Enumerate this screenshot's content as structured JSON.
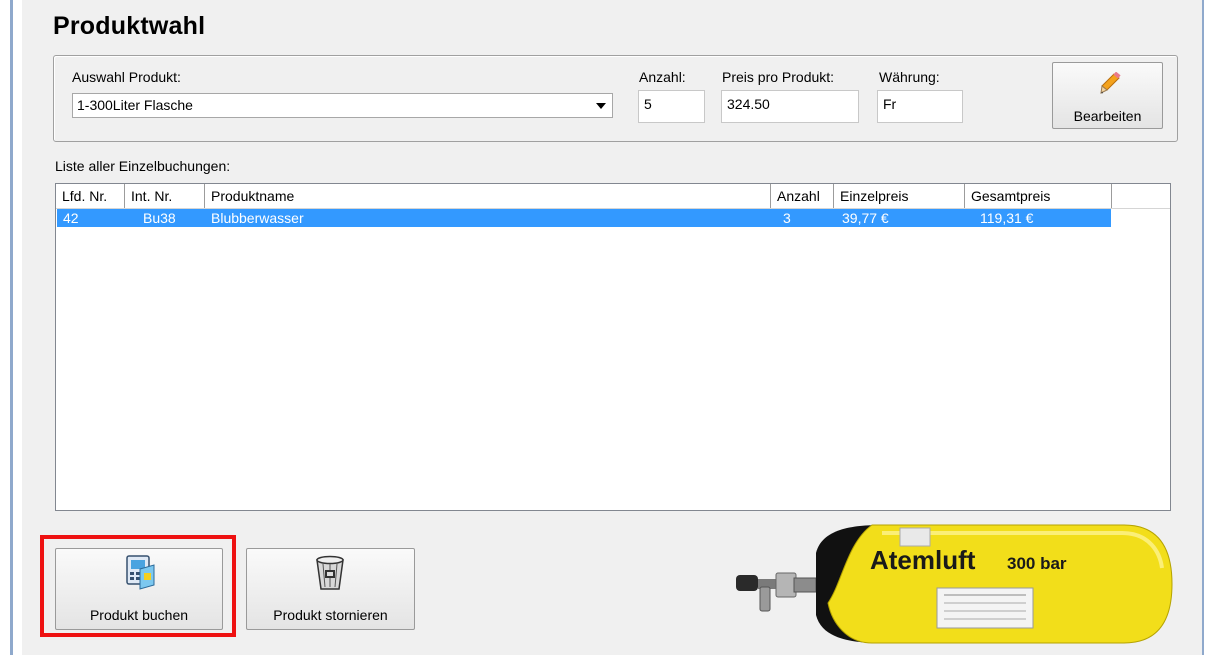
{
  "title": "Produktwahl",
  "selection": {
    "product_label": "Auswahl Produkt:",
    "product_value": "1-300Liter Flasche",
    "quantity_label": "Anzahl:",
    "quantity_value": "5",
    "price_label": "Preis pro Produkt:",
    "price_value": "324.50",
    "currency_label": "Währung:",
    "currency_value": "Fr",
    "edit_button": "Bearbeiten",
    "edit_icon": "pencil-icon"
  },
  "bookings": {
    "label": "Liste aller Einzelbuchungen:",
    "columns": [
      "Lfd. Nr.",
      "Int. Nr.",
      "Produktname",
      "Anzahl",
      "Einzelpreis",
      "Gesamtpreis"
    ],
    "rows": [
      {
        "lfd": "42",
        "int": "Bu38",
        "name": "Blubberwasser",
        "anzahl": "3",
        "einzelpreis": "39,77 €",
        "gesamtpreis": "119,31 €"
      }
    ],
    "selected_row_color": "#3399ff"
  },
  "actions": {
    "book_button": "Produkt buchen",
    "book_icon": "book-product-icon",
    "cancel_button": "Produkt stornieren",
    "cancel_icon": "trash-bin-icon",
    "highlight_color": "#ee1111"
  },
  "tank_image": {
    "label_main": "Atemluft",
    "label_pressure": "300 bar",
    "color": "#f2de1a"
  }
}
